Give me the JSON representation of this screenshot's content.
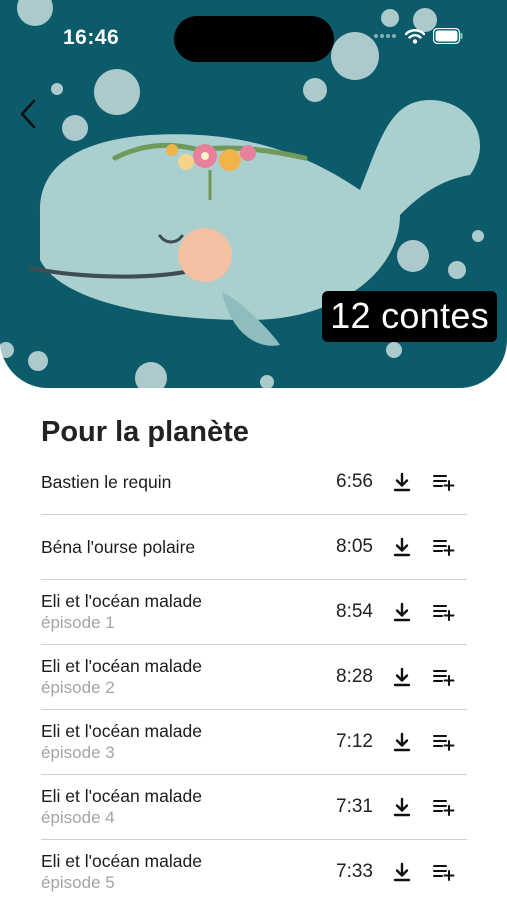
{
  "status_bar": {
    "time": "16:46"
  },
  "hero": {
    "badge": "12 contes"
  },
  "section": {
    "title": "Pour la planète"
  },
  "tracks": [
    {
      "title": "Bastien le requin",
      "subtitle": "",
      "duration": "6:56"
    },
    {
      "title": "Béna l'ourse polaire",
      "subtitle": "",
      "duration": "8:05"
    },
    {
      "title": "Eli et l'océan malade",
      "subtitle": "épisode 1",
      "duration": "8:54"
    },
    {
      "title": "Eli et l'océan malade",
      "subtitle": "épisode 2",
      "duration": "8:28"
    },
    {
      "title": "Eli et l'océan malade",
      "subtitle": "épisode 3",
      "duration": "7:12"
    },
    {
      "title": "Eli et l'océan malade",
      "subtitle": "épisode 4",
      "duration": "7:31"
    },
    {
      "title": "Eli et l'océan malade",
      "subtitle": "épisode 5",
      "duration": "7:33"
    }
  ],
  "icons": {
    "back": "chevron-left-icon",
    "download": "download-icon",
    "playlist": "playlist-add-icon"
  },
  "colors": {
    "hero_background": "#0b5b6a",
    "whale": "#a9cfcf",
    "cheek": "#f4c0a2"
  }
}
